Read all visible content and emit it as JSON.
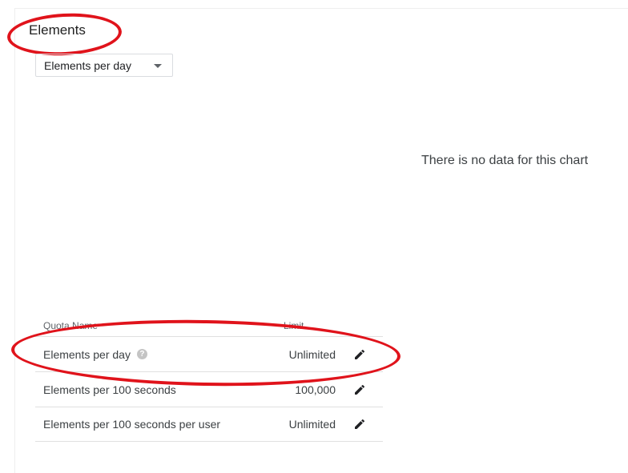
{
  "section": {
    "title": "Elements"
  },
  "metric_selector": {
    "selected": "Elements per day"
  },
  "chart": {
    "empty_message": "There is no data for this chart"
  },
  "quota_table": {
    "headers": {
      "name": "Quota Name",
      "limit": "Limit"
    },
    "rows": [
      {
        "name": "Elements per day",
        "limit": "Unlimited",
        "has_help_icon": true
      },
      {
        "name": "Elements per 100 seconds",
        "limit": "100,000",
        "has_help_icon": false
      },
      {
        "name": "Elements per 100 seconds per user",
        "limit": "Unlimited",
        "has_help_icon": false
      }
    ],
    "help_glyph": "?"
  },
  "icons": {
    "dropdown": "caret-down-icon",
    "edit": "pencil-icon",
    "help": "help-circle-icon"
  },
  "colors": {
    "annotation": "#e0131b",
    "text_primary": "#202124",
    "text_secondary": "#5f6368"
  }
}
